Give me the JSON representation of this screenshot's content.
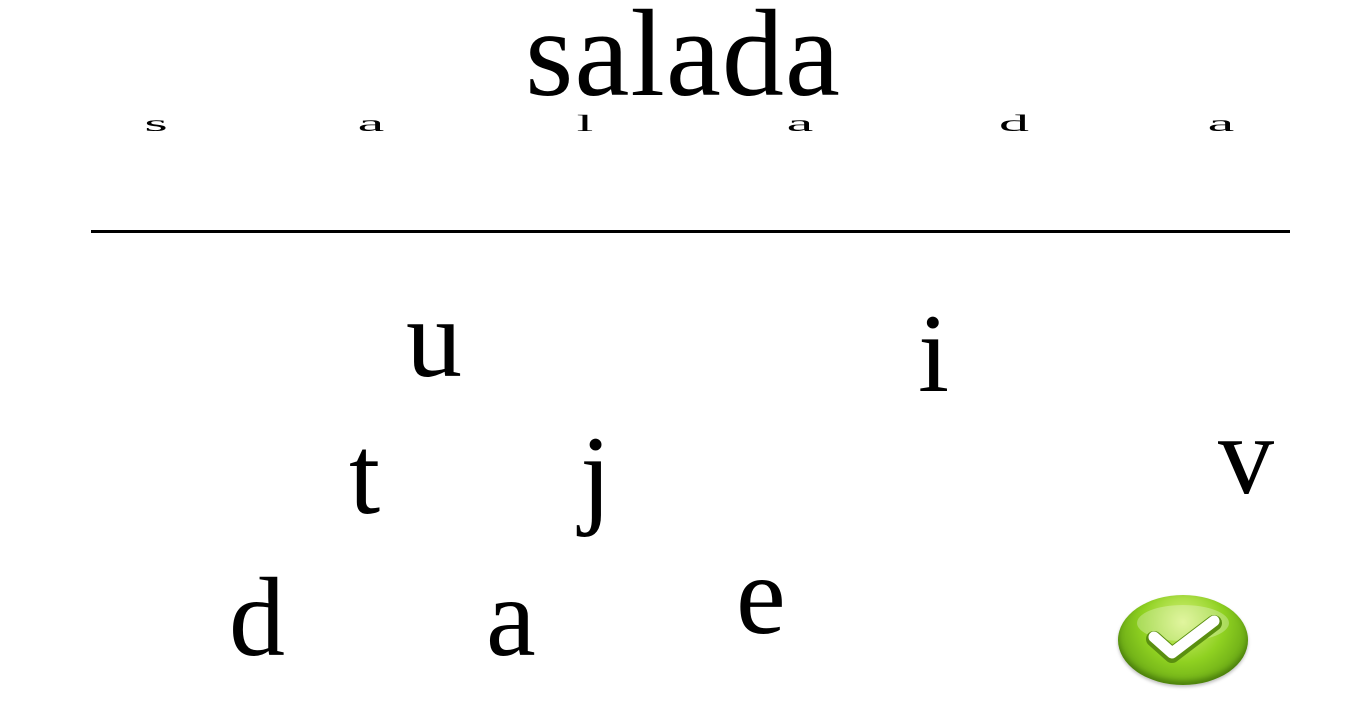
{
  "word": "salada",
  "slots": [
    "s",
    "a",
    "l",
    "a",
    "d",
    "a"
  ],
  "tiles": [
    {
      "letter": "u"
    },
    {
      "letter": "i"
    },
    {
      "letter": "t"
    },
    {
      "letter": "j"
    },
    {
      "letter": "v"
    },
    {
      "letter": "d"
    },
    {
      "letter": "a"
    },
    {
      "letter": "e"
    }
  ],
  "confirm_button": {
    "icon": "checkmark-icon",
    "color": "#8fd121"
  }
}
